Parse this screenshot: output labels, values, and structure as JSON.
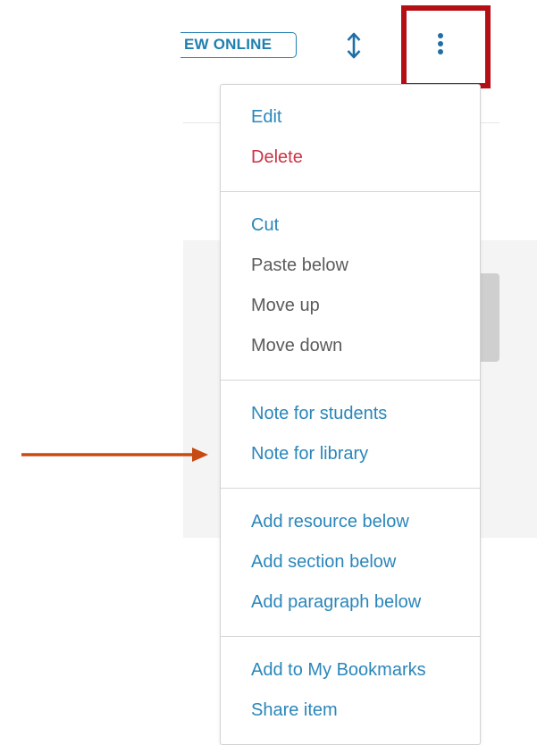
{
  "header": {
    "view_online_label": "EW ONLINE",
    "sort_icon": "vertical-arrows-icon",
    "more_icon": "kebab-icon"
  },
  "menu": {
    "groups": [
      {
        "items": [
          {
            "label": "Edit"
          },
          {
            "label": "Delete"
          }
        ]
      },
      {
        "items": [
          {
            "label": "Cut"
          },
          {
            "label": "Paste below"
          },
          {
            "label": "Move up"
          },
          {
            "label": "Move down"
          }
        ]
      },
      {
        "items": [
          {
            "label": "Note for students"
          },
          {
            "label": "Note for library"
          }
        ]
      },
      {
        "items": [
          {
            "label": "Add resource below"
          },
          {
            "label": "Add section below"
          },
          {
            "label": "Add paragraph below"
          }
        ]
      },
      {
        "items": [
          {
            "label": "Add to My Bookmarks"
          },
          {
            "label": "Share item"
          }
        ]
      }
    ]
  },
  "colors": {
    "link_blue": "#2a86ba",
    "danger_red": "#cc3347",
    "disabled_grey": "#5b5b5b",
    "highlight_red": "#b50f16",
    "annotation_arrow": "#c74a12"
  }
}
